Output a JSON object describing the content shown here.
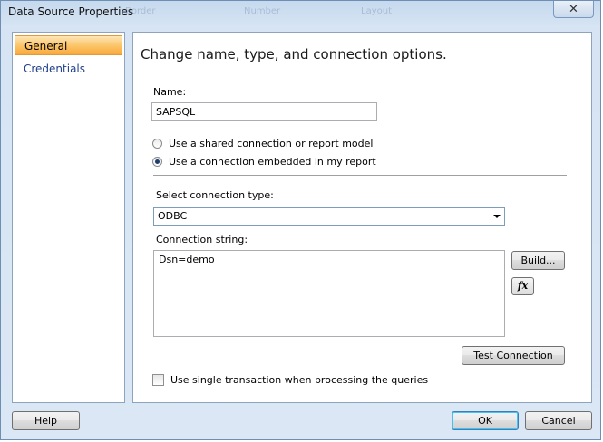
{
  "window": {
    "title": "Data Source Properties",
    "close_label": "✕",
    "background_labels": [
      "Border",
      "Number",
      "Layout"
    ]
  },
  "nav": {
    "items": [
      {
        "label": "General",
        "selected": true
      },
      {
        "label": "Credentials",
        "selected": false
      }
    ]
  },
  "content": {
    "heading": "Change name, type, and connection options.",
    "name_label": "Name:",
    "name_value": "SAPSQL",
    "radio_shared": "Use a shared connection or report model",
    "radio_embedded": "Use a connection embedded in my report",
    "selected_radio": "embedded",
    "connection_type_label": "Select connection type:",
    "connection_type_value": "ODBC",
    "connection_string_label": "Connection string:",
    "connection_string_value": "Dsn=demo",
    "build_button": "Build...",
    "fx_button": "fx",
    "test_connection_button": "Test Connection",
    "single_transaction_label": "Use single transaction when processing the queries",
    "single_transaction_checked": false
  },
  "footer": {
    "help_button": "Help",
    "ok_button": "OK",
    "cancel_button": "Cancel"
  },
  "colors": {
    "selected_nav": "#f9a83a",
    "nav_text": "#1f3f8a",
    "window_frame": "#6d8fb3"
  }
}
